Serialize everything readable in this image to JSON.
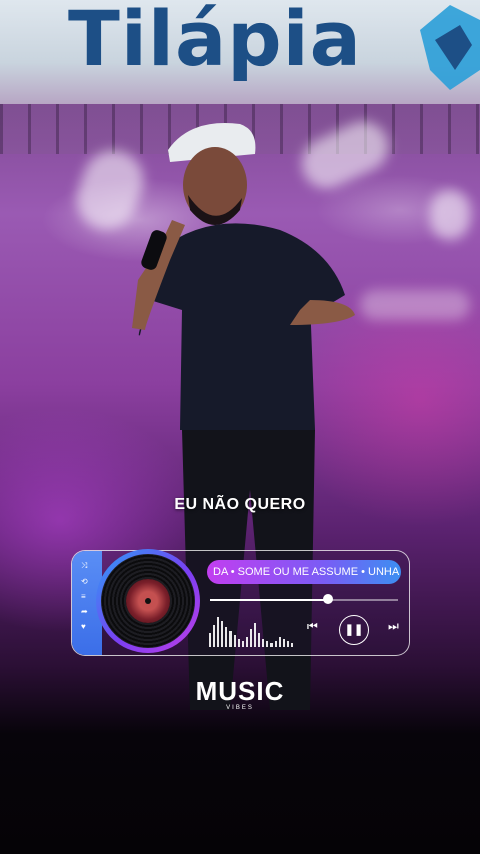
{
  "banner": {
    "title": "Tilápia"
  },
  "lyric": {
    "text": "EU NÃO QUERO"
  },
  "player": {
    "track_title": "DA • SOME OU ME ASSUME • UNHA",
    "progress_fraction": 0.63,
    "controls": {
      "prev_glyph": "⏮",
      "pause_glyph": "❚❚",
      "next_glyph": "⏭"
    },
    "side_icons": [
      "heart-icon",
      "share-icon",
      "list-icon",
      "shuffle-icon",
      "repeat-icon",
      "close-icon"
    ]
  },
  "brand": {
    "name": "MUSIC",
    "tagline": "VIBES"
  },
  "colors": {
    "accent_pink": "#c23ef0",
    "accent_blue": "#3c8ff2",
    "banner_text": "#1d4f86"
  }
}
